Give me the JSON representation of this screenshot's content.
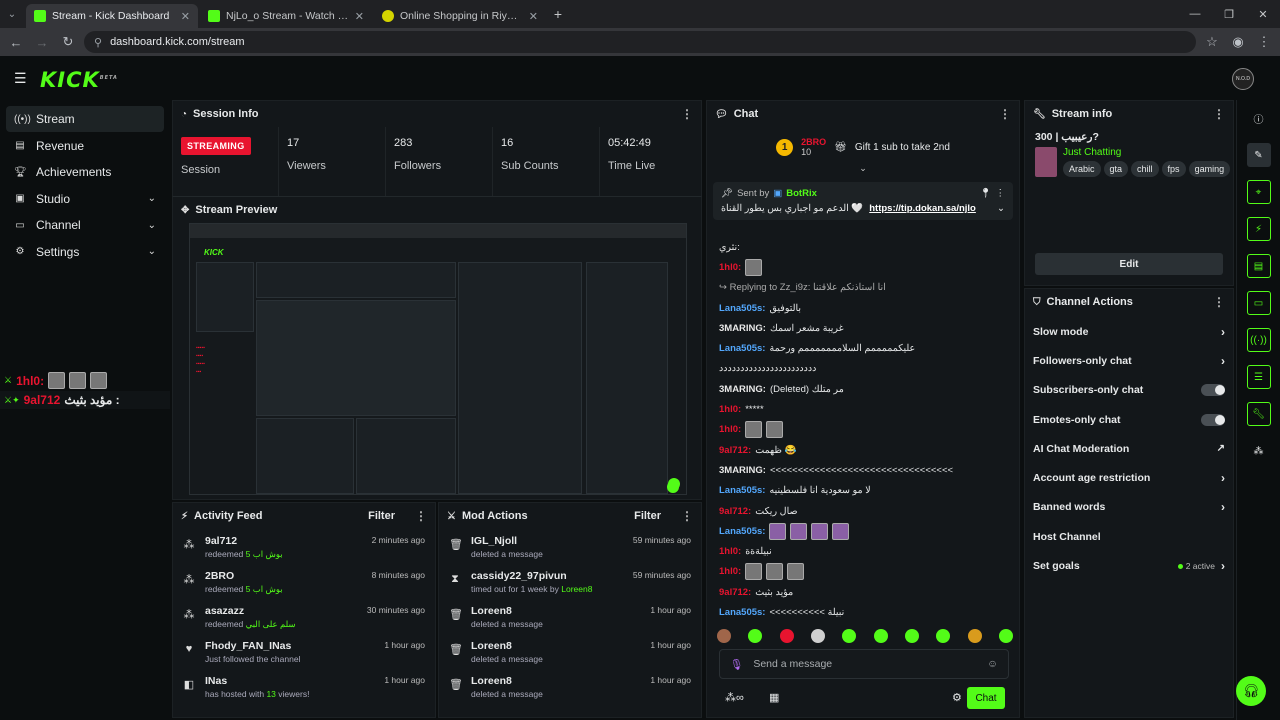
{
  "browser": {
    "tabs": [
      {
        "title": "Stream - Kick Dashboard",
        "color": "#53fc18"
      },
      {
        "title": "NjLo_o Stream - Watch Live on",
        "color": "#53fc18"
      },
      {
        "title": "Online Shopping in Riyadh, Jed",
        "color": "#d4d400"
      }
    ],
    "url": "dashboard.kick.com/stream"
  },
  "app": {
    "logo": "KICK",
    "logo_sup": "BETA",
    "avatar_text": "N.O.D"
  },
  "sidenav": {
    "items": [
      {
        "label": "Stream",
        "icon": "stream-icon",
        "chev": ""
      },
      {
        "label": "Revenue",
        "icon": "revenue-icon",
        "chev": ""
      },
      {
        "label": "Achievements",
        "icon": "trophy-icon",
        "chev": ""
      },
      {
        "label": "Studio",
        "icon": "studio-icon",
        "chev": "⌄"
      },
      {
        "label": "Channel",
        "icon": "channel-icon",
        "chev": "⌄"
      },
      {
        "label": "Settings",
        "icon": "gear-icon",
        "chev": "⌄"
      }
    ]
  },
  "overlay_chat": {
    "line1_user": "1hl0:",
    "line2_user": "9al712",
    "line2_text": "مؤيد بثيث :"
  },
  "session": {
    "title": "Session Info",
    "badge": "STREAMING",
    "session_label": "Session",
    "viewers_value": "17",
    "viewers_label": "Viewers",
    "followers_value": "283",
    "followers_label": "Followers",
    "subs_value": "16",
    "subs_label": "Sub Counts",
    "time_value": "05:42:49",
    "time_label": "Time Live"
  },
  "preview": {
    "title": "Stream Preview"
  },
  "activity": {
    "title": "Activity Feed",
    "filter": "Filter",
    "items": [
      {
        "name": "9al712",
        "pre": "redeemed",
        "hl": "بوش اب 5",
        "post": "",
        "time": "2 minutes ago",
        "icon": "redeem-icon"
      },
      {
        "name": "2BRO",
        "pre": "redeemed",
        "hl": "بوش اب 5",
        "post": "",
        "time": "8 minutes ago",
        "icon": "redeem-icon"
      },
      {
        "name": "asazazz",
        "pre": "redeemed",
        "hl": "سلم على البي",
        "post": "",
        "time": "30 minutes ago",
        "icon": "redeem-icon"
      },
      {
        "name": "Fhody_FAN_INas",
        "pre": "Just followed the channel",
        "hl": "",
        "post": "",
        "time": "1 hour ago",
        "icon": "heart-icon"
      },
      {
        "name": "INas",
        "pre": "has hosted with",
        "hl": "13",
        "post": "viewers!",
        "time": "1 hour ago",
        "icon": "host-icon"
      }
    ]
  },
  "mod": {
    "title": "Mod Actions",
    "filter": "Filter",
    "items": [
      {
        "name": "IGL_Njoll",
        "pre": "deleted a message",
        "hl": "",
        "time": "59 minutes ago",
        "icon": "trash-icon"
      },
      {
        "name": "cassidy22_97pivun",
        "pre": "timed out for 1 week by",
        "hl": "Loreen8",
        "time": "59 minutes ago",
        "icon": "hourglass-icon"
      },
      {
        "name": "Loreen8",
        "pre": "deleted a message",
        "hl": "",
        "time": "1 hour ago",
        "icon": "trash-icon"
      },
      {
        "name": "Loreen8",
        "pre": "deleted a message",
        "hl": "",
        "time": "1 hour ago",
        "icon": "trash-icon"
      },
      {
        "name": "Loreen8",
        "pre": "deleted a message",
        "hl": "",
        "time": "1 hour ago",
        "icon": "trash-icon"
      }
    ]
  },
  "chat": {
    "title": "Chat",
    "gift_user": "2BRO",
    "gift_count": "10",
    "gift_text": "Gift 1 sub to take 2nd",
    "pinned_by_label": "Sent by",
    "pinned_by": "BotRix",
    "pinned_text": "الدعم مو اجباري بس يطور القناة 🤍",
    "pinned_link": "https://tip.dokan.sa/njlo",
    "messages": [
      {
        "user": "",
        "color": "#e8e8e8",
        "text": "نثري:",
        "emotes": 0
      },
      {
        "user": "1hl0:",
        "color": "#e8142f",
        "text": "",
        "emotes": 1
      },
      {
        "user": "",
        "color": "#aaa",
        "text": "↪ Replying to Zz_i9z: انا استاذنكم علاقتنا",
        "emotes": 0
      },
      {
        "user": "Lana505s:",
        "color": "#53a7fc",
        "text": "بالتوفيق",
        "emotes": 0
      },
      {
        "user": "3MARING:",
        "color": "#e8e8e8",
        "text": "غريبة مشعر اسمك",
        "emotes": 0
      },
      {
        "user": "Lana505s:",
        "color": "#53a7fc",
        "text": "عليكمممممم السلامممممممم ورحمة",
        "emotes": 0
      },
      {
        "user": "",
        "color": "#e8e8e8",
        "text": "ددددددددددددددددددددددد",
        "emotes": 0
      },
      {
        "user": "3MARING:",
        "color": "#e8e8e8",
        "text": "(Deleted) مر متلك",
        "emotes": 0
      },
      {
        "user": "1hl0:",
        "color": "#e8142f",
        "text": "*****",
        "emotes": 0
      },
      {
        "user": "1hl0:",
        "color": "#e8142f",
        "text": "",
        "emotes": 2
      },
      {
        "user": "9al712:",
        "color": "#e8142f",
        "text": "ظهمت 😂",
        "emotes": 0
      },
      {
        "user": "3MARING:",
        "color": "#e8e8e8",
        "text": "<<<<<<<<<<<<<<<<<<<<<<<<<<<<<<<<<",
        "emotes": 0
      },
      {
        "user": "Lana505s:",
        "color": "#53a7fc",
        "text": "لا مو سعودية انا فلسطينيه",
        "emotes": 0
      },
      {
        "user": "9al712:",
        "color": "#e8142f",
        "text": "صال ريكت",
        "emotes": 0
      },
      {
        "user": "Lana505s:",
        "color": "#53a7fc",
        "text": "",
        "emotes": 4
      },
      {
        "user": "1hl0:",
        "color": "#e8142f",
        "text": "نبيلةةة",
        "emotes": 0
      },
      {
        "user": "1hl0:",
        "color": "#e8142f",
        "text": "",
        "emotes": 3
      },
      {
        "user": "9al712:",
        "color": "#e8142f",
        "text": "مؤيد بثيث",
        "emotes": 0
      },
      {
        "user": "Lana505s:",
        "color": "#53a7fc",
        "text": "<<<<<<<<<< نبيلة",
        "emotes": 0
      }
    ],
    "input_placeholder": "Send a message",
    "send_label": "Chat"
  },
  "stream_info": {
    "title": "Stream info",
    "stream_title": "رعيبيب | 300?",
    "category": "Just Chatting",
    "tags": [
      "Arabic",
      "gta",
      "chill",
      "fps",
      "gaming"
    ],
    "edit_label": "Edit"
  },
  "channel_actions": {
    "title": "Channel Actions",
    "rows": [
      {
        "label": "Slow mode",
        "kind": "chevron"
      },
      {
        "label": "Followers-only chat",
        "kind": "chevron"
      },
      {
        "label": "Subscribers-only chat",
        "kind": "toggle"
      },
      {
        "label": "Emotes-only chat",
        "kind": "toggle"
      },
      {
        "label": "AI Chat Moderation",
        "kind": "external"
      },
      {
        "label": "Account age restriction",
        "kind": "chevron"
      },
      {
        "label": "Banned words",
        "kind": "chevron"
      },
      {
        "label": "Host Channel",
        "kind": "none"
      },
      {
        "label": "Set goals",
        "kind": "goal"
      }
    ],
    "goal_status": "2 active"
  },
  "colors": {
    "brand": "#53fc18",
    "live": "#e8142f"
  }
}
